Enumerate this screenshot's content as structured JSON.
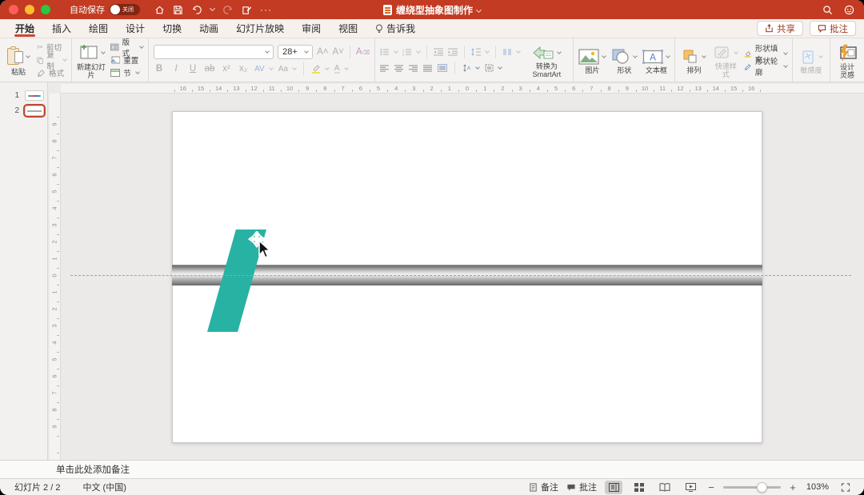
{
  "titlebar": {
    "autosave_label": "自动保存",
    "autosave_state": "关闭",
    "more": "···",
    "title": "缠绕型抽象图制作"
  },
  "tabs": {
    "items": [
      "开始",
      "插入",
      "绘图",
      "设计",
      "切换",
      "动画",
      "幻灯片放映",
      "审阅",
      "视图",
      "告诉我"
    ],
    "active_index": 0,
    "share_label": "共享",
    "comment_label": "批注"
  },
  "ribbon": {
    "paste": "粘贴",
    "cut": "剪切",
    "copy": "复制",
    "format_painter": "格式",
    "new_slide": "新建幻灯片",
    "layout": "版式",
    "reset": "重置",
    "section": "节",
    "font_size": "28+",
    "bold": "B",
    "italic": "I",
    "underline": "U",
    "strike": "ab",
    "superscript": "x²",
    "subscript": "x₂",
    "char_spacing": "AV",
    "change_case": "Aa",
    "font_color": "A",
    "convert_smartart": "转换为SmartArt",
    "picture": "图片",
    "shapes": "形状",
    "textbox": "文本框",
    "arrange": "排列",
    "quick_styles": "快速样式",
    "shape_fill": "形状填充",
    "shape_outline": "形状轮廓",
    "sensitivity": "敏感度",
    "design_ideas": "设计灵感"
  },
  "slides_panel": {
    "items": [
      {
        "number": "1"
      },
      {
        "number": "2"
      }
    ],
    "selected_index": 1
  },
  "canvas": {
    "h_ruler": [
      16,
      15,
      14,
      13,
      12,
      11,
      10,
      9,
      8,
      7,
      6,
      5,
      4,
      3,
      2,
      1,
      0,
      1,
      2,
      3,
      4,
      5,
      6,
      7,
      8,
      9,
      10,
      11,
      12,
      13,
      14,
      15,
      16
    ],
    "v_ruler": [
      9,
      8,
      7,
      6,
      5,
      4,
      3,
      2,
      1,
      0,
      1,
      2,
      3,
      4,
      5,
      6,
      7,
      8,
      9
    ],
    "shape_color": "#28b2a3"
  },
  "notes": {
    "placeholder": "单击此处添加备注"
  },
  "statusbar": {
    "slide_indicator": "幻灯片 2 / 2",
    "language": "中文 (中国)",
    "notes_label": "备注",
    "comments_label": "批注",
    "zoom_out": "−",
    "zoom_in": "+",
    "zoom_level": "103%"
  }
}
